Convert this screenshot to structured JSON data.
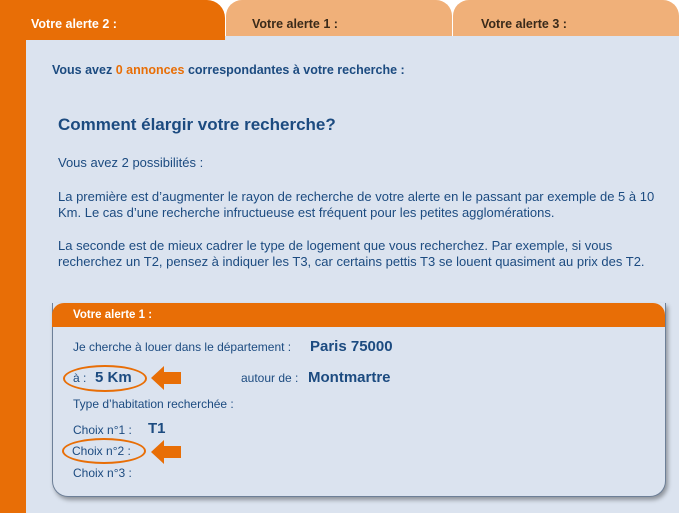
{
  "tabs": [
    {
      "label": "Votre alerte 2 :",
      "active": true
    },
    {
      "label": "Votre alerte 1 :",
      "active": false
    },
    {
      "label": "Votre alerte 3 :",
      "active": false
    }
  ],
  "results": {
    "prefix": "Vous avez ",
    "count": "0 annonces",
    "suffix": " correspondantes à votre recherche :"
  },
  "help": {
    "heading": "Comment élargir votre recherche?",
    "intro": "Vous avez 2 possibilités :",
    "first": "La première est d’augmenter le rayon de recherche de votre alerte en le passant par exemple de 5 à 10 Km. Le cas d’une recherche infructueuse est fréquent pour les petites agglomérations.",
    "second": "La seconde est de mieux cadrer le type de logement que vous recherchez. Par exemple, si vous recherchez un T2, pensez à indiquer les T3, car certains pettis T3 se louent quasiment au prix des T2."
  },
  "alert": {
    "title": "Votre alerte 1 :",
    "department_label": "Je cherche à louer dans le département :",
    "department_value": "Paris 75000",
    "radius_label": "à :",
    "radius_value": "5 Km",
    "around_label": "autour de :",
    "around_value": "Montmartre",
    "type_label": "Type d’habitation recherchée :",
    "choice1_label": "Choix n°1 :",
    "choice1_value": "T1",
    "choice2_label": "Choix n°2 :",
    "choice3_label": "Choix n°3 :"
  },
  "colors": {
    "accent": "#e86e06",
    "tab_inactive": "#f0b079",
    "panel": "#dbe3ef",
    "text": "#1c4b80"
  },
  "icons": {
    "arrow": "arrow-left-icon",
    "highlight": "highlight-oval"
  }
}
